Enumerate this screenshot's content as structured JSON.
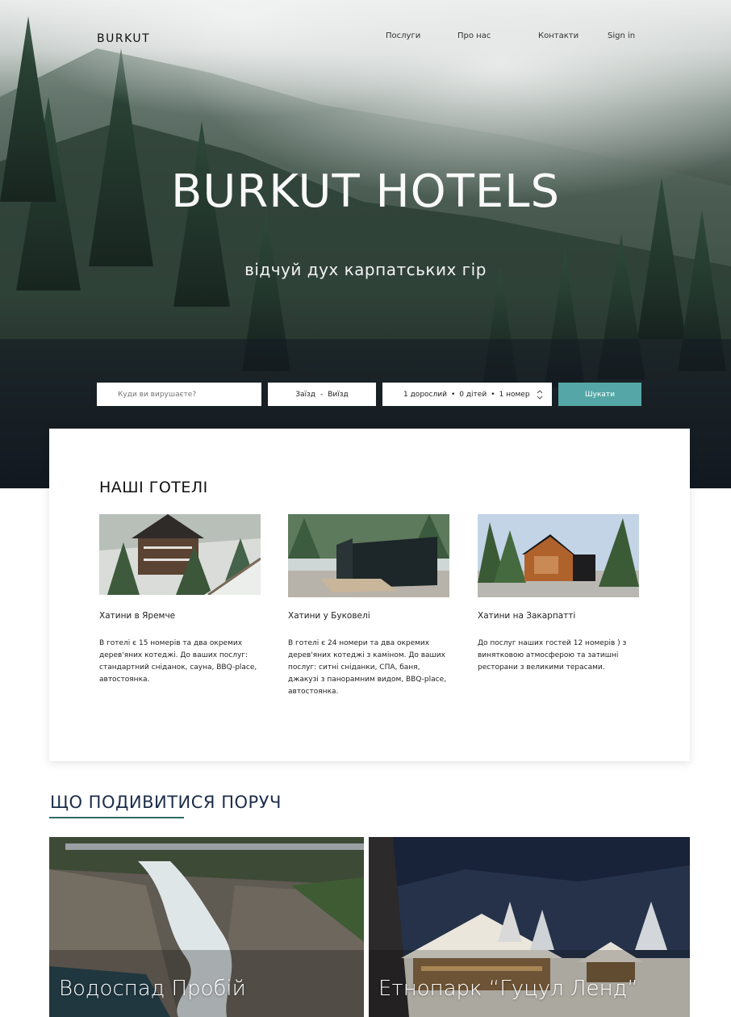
{
  "header": {
    "logo": "BURKUT",
    "nav": [
      {
        "label": "Послуги"
      },
      {
        "label": "Про нас"
      },
      {
        "label": "Контакти"
      },
      {
        "label": "Sign in"
      }
    ]
  },
  "hero": {
    "title": "BURKUT HOTELS",
    "subtitle": "відчуй дух карпатських гір"
  },
  "search": {
    "destination_placeholder": "Куди ви вирушаєте?",
    "checkin": "Заїзд",
    "separator": "-",
    "checkout": "Виїзд",
    "adults": "1 дорослий",
    "children": "0 дітей",
    "rooms": "1 номер",
    "dot": "•",
    "button": "Шукати"
  },
  "hotels": {
    "title": "НАШІ ГОТЕЛІ",
    "items": [
      {
        "name": "Хатини в Яремче",
        "description": "В готелі є 15 номерів та два окремих дерев'яних котеджі. До ваших послуг: стандартний сніданок, сауна, BBQ-place, автостоянка."
      },
      {
        "name": "Хатини у Буковелі",
        "description": "В готелі є 24 номери та два окремих дерев'яних котеджі з каміном. До ваших послуг: ситні сніданки, СПА, баня, джакузі з панорамним видом, BBQ-place, автостоянка."
      },
      {
        "name": "Хатини на Закарпатті",
        "description": "До послуг наших гостей 12 номерів ) з винятковою атмосферою та затишні ресторани з великими терасами."
      }
    ]
  },
  "nearby": {
    "title": "ЩО ПОДИВИТИСЯ ПОРУЧ",
    "items": [
      {
        "caption": "Водоспад Пробій"
      },
      {
        "caption": "Етнопарк “Гуцул Ленд”"
      }
    ]
  },
  "colors": {
    "accent": "#54a7a6",
    "heading_navy": "#1c2d4a",
    "underline": "#2f6b68"
  }
}
